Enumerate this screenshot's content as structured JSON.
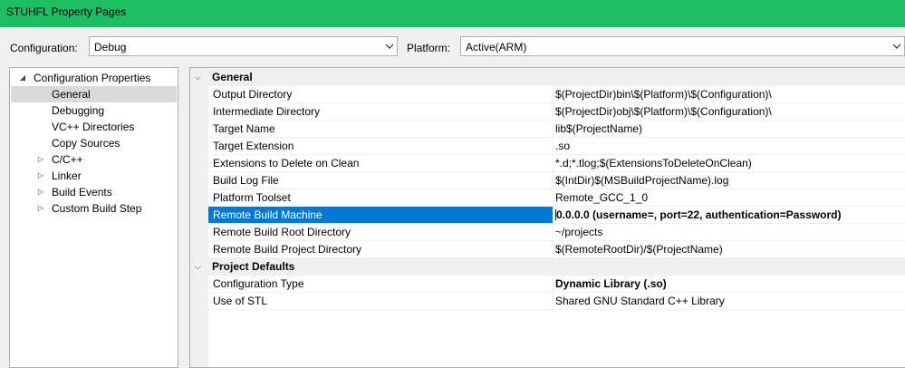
{
  "window": {
    "title": "STUHFL Property Pages"
  },
  "toolbar": {
    "configuration_label": "Configuration:",
    "configuration_value": "Debug",
    "platform_label": "Platform:",
    "platform_value": "Active(ARM)"
  },
  "tree": {
    "root": "Configuration Properties",
    "items": [
      {
        "label": "General",
        "expandable": false,
        "selected": true
      },
      {
        "label": "Debugging",
        "expandable": false
      },
      {
        "label": "VC++ Directories",
        "expandable": false
      },
      {
        "label": "Copy Sources",
        "expandable": false
      },
      {
        "label": "C/C++",
        "expandable": true
      },
      {
        "label": "Linker",
        "expandable": true
      },
      {
        "label": "Build Events",
        "expandable": true
      },
      {
        "label": "Custom Build Step",
        "expandable": true
      }
    ]
  },
  "grid": {
    "categories": [
      {
        "name": "General",
        "rows": [
          {
            "name": "Output Directory",
            "value": "$(ProjectDir)bin\\$(Platform)\\$(Configuration)\\"
          },
          {
            "name": "Intermediate Directory",
            "value": "$(ProjectDir)obj\\$(Platform)\\$(Configuration)\\"
          },
          {
            "name": "Target Name",
            "value": "lib$(ProjectName)"
          },
          {
            "name": "Target Extension",
            "value": ".so"
          },
          {
            "name": "Extensions to Delete on Clean",
            "value": "*.d;*.tlog;$(ExtensionsToDeleteOnClean)"
          },
          {
            "name": "Build Log File",
            "value": "$(IntDir)$(MSBuildProjectName).log"
          },
          {
            "name": "Platform Toolset",
            "value": "Remote_GCC_1_0"
          },
          {
            "name": "Remote Build Machine",
            "value": "0.0.0.0 (username=, port=22, authentication=Password)",
            "bold": true,
            "selected": true
          },
          {
            "name": "Remote Build Root Directory",
            "value": "~/projects"
          },
          {
            "name": "Remote Build Project Directory",
            "value": "$(RemoteRootDir)/$(ProjectName)"
          }
        ]
      },
      {
        "name": "Project Defaults",
        "rows": [
          {
            "name": "Configuration Type",
            "value": "Dynamic Library (.so)",
            "bold": true
          },
          {
            "name": "Use of STL",
            "value": "Shared GNU Standard C++ Library"
          }
        ]
      }
    ]
  },
  "colors": {
    "titlebar": "#1dbd62",
    "selection": "#0078d7",
    "tree_selection": "#d9d9d9"
  }
}
